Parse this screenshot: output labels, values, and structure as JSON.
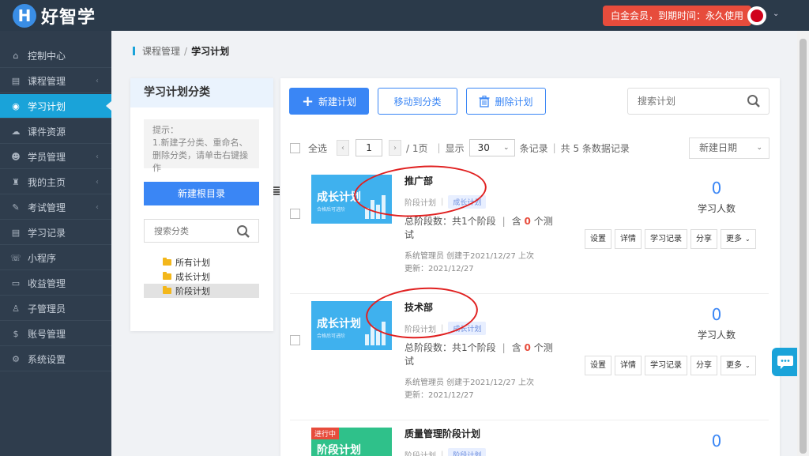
{
  "header": {
    "logo_letter": "H",
    "logo_text": "好智学",
    "member_badge": "白金会员，到期时间：永久使用",
    "avatar_caret": "⌄"
  },
  "sidebar": {
    "items": [
      {
        "label": "控制中心",
        "icon": "⌂",
        "icon_name": "home-icon",
        "has_chevron": false
      },
      {
        "label": "课程管理",
        "icon": "▤",
        "icon_name": "book-icon",
        "has_chevron": true
      },
      {
        "label": "学习计划",
        "icon": "◉",
        "icon_name": "eye-icon",
        "has_chevron": false,
        "active": true
      },
      {
        "label": "课件资源",
        "icon": "☁",
        "icon_name": "cloud-icon",
        "has_chevron": false
      },
      {
        "label": "学员管理",
        "icon": "☻",
        "icon_name": "users-icon",
        "has_chevron": true
      },
      {
        "label": "我的主页",
        "icon": "♜",
        "icon_name": "graduation-cap-icon",
        "has_chevron": true
      },
      {
        "label": "考试管理",
        "icon": "✎",
        "icon_name": "tag-icon",
        "has_chevron": true
      },
      {
        "label": "学习记录",
        "icon": "▤",
        "icon_name": "record-icon",
        "has_chevron": false
      },
      {
        "label": "小程序",
        "icon": "☏",
        "icon_name": "wechat-icon",
        "has_chevron": false
      },
      {
        "label": "收益管理",
        "icon": "▭",
        "icon_name": "card-icon",
        "has_chevron": false
      },
      {
        "label": "子管理员",
        "icon": "♙",
        "icon_name": "user-icon",
        "has_chevron": false
      },
      {
        "label": "账号管理",
        "icon": "$",
        "icon_name": "dollar-icon",
        "has_chevron": false
      },
      {
        "label": "系统设置",
        "icon": "⚙",
        "icon_name": "gear-icon",
        "has_chevron": false
      }
    ],
    "chevron": "‹"
  },
  "breadcrumb": {
    "parent": "课程管理",
    "sep": "/",
    "current": "学习计划"
  },
  "category": {
    "title": "学习计划分类",
    "tip_title": "提示：",
    "tip_body": "1.新建子分类、重命名、删除分类，请单击右键操作",
    "new_root_label": "新建根目录",
    "search_placeholder": "搜索分类",
    "tree": [
      "所有计划",
      "成长计划",
      "阶段计划"
    ],
    "selected_index": 2
  },
  "toolbar": {
    "new_label": "新建计划",
    "move_label": "移动到分类",
    "delete_label": "删除计划",
    "search_placeholder": "搜索计划"
  },
  "listbar": {
    "select_all": "全选",
    "prev": "‹",
    "next": "›",
    "page": "1",
    "total_pages": "/ 1页",
    "show": "显示",
    "per_page": "30",
    "records_suffix": "条记录",
    "total_records": "共 5 条数据记录",
    "sort": "新建日期"
  },
  "plans": [
    {
      "name": "推广部",
      "type": "阶段计划",
      "tag": "成长计划",
      "thumb_title": "成长计划",
      "thumb_sub": "合格后可进阶",
      "stages_text": "总阶段数：共1个阶段",
      "tests_prefix": "含",
      "tests_count": "0",
      "tests_suffix": "个测试",
      "creator": "系统管理员 创建于2021/12/27 上次更新：2021/12/27",
      "learners": "0",
      "learners_label": "学习人数",
      "actions": [
        "设置",
        "详情",
        "学习记录",
        "分享",
        "更多"
      ]
    },
    {
      "name": "技术部",
      "type": "阶段计划",
      "tag": "成长计划",
      "thumb_title": "成长计划",
      "thumb_sub": "合格后可进阶",
      "stages_text": "总阶段数：共1个阶段",
      "tests_prefix": "含",
      "tests_count": "0",
      "tests_suffix": "个测试",
      "creator": "系统管理员 创建于2021/12/27 上次更新：2021/12/27",
      "learners": "0",
      "learners_label": "学习人数",
      "actions": [
        "设置",
        "详情",
        "学习记录",
        "分享",
        "更多"
      ]
    },
    {
      "name": "质量管理阶段计划",
      "type": "阶段计划",
      "tag": "阶段计划",
      "thumb_title": "阶段计划",
      "ribbon": "进行中",
      "learners": "0"
    }
  ],
  "colors": {
    "accent": "#3a86f5",
    "active_nav": "#1aa3d9",
    "badge": "#e74c3c",
    "annotation": "#e02020"
  }
}
